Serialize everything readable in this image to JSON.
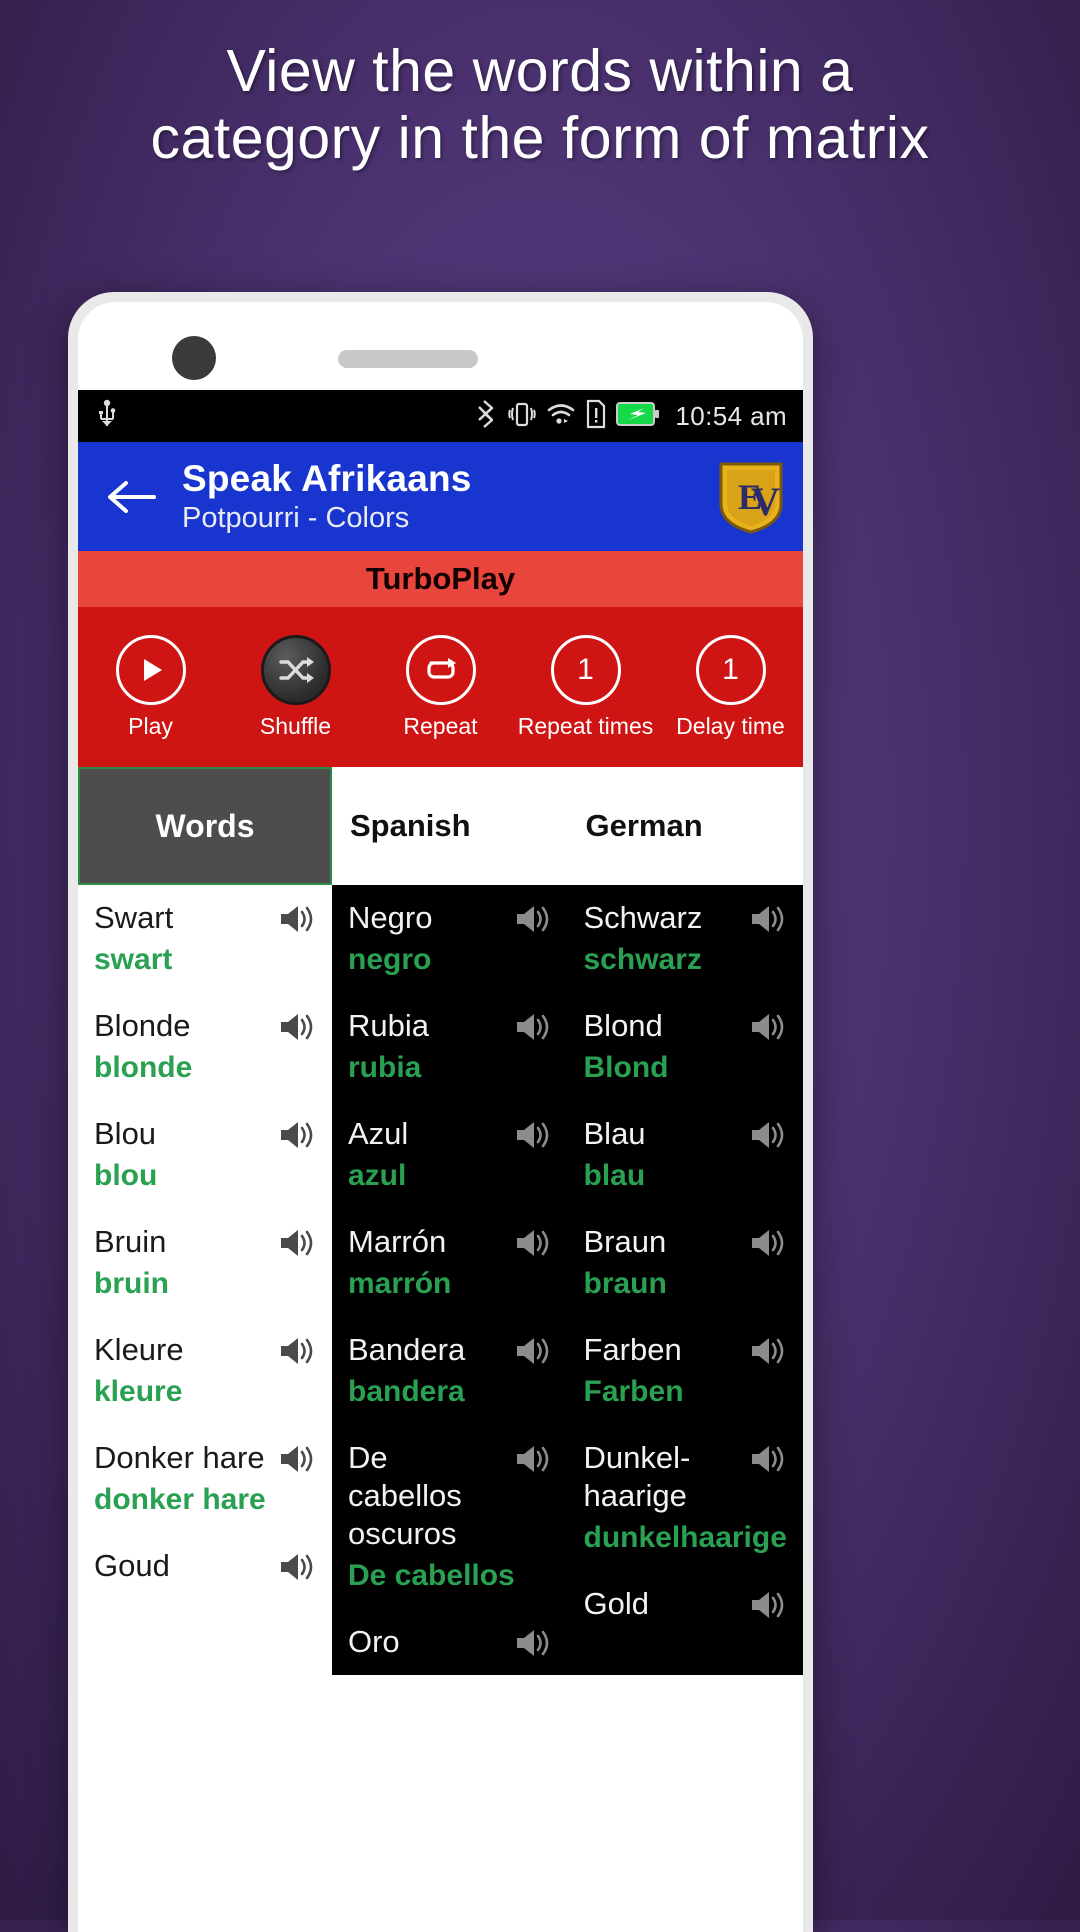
{
  "headline": "View the words within a category in the form of matrix",
  "statusbar": {
    "clock": "10:54 am",
    "left_icons": [
      "usb-icon"
    ],
    "right_icons": [
      "bluetooth-icon",
      "vibrate-icon",
      "wifi-icon",
      "sim-alert-icon",
      "battery-charging-icon"
    ]
  },
  "appbar": {
    "back_icon": "back-arrow-icon",
    "title": "Speak Afrikaans",
    "subtitle": "Potpourri - Colors",
    "logo_text": "EV",
    "bg_color": "#1836cf"
  },
  "turboplay": {
    "title": "TurboPlay",
    "title_bg": "#e8453c",
    "bar_bg": "#cf1414",
    "controls": [
      {
        "label": "Play",
        "icon": "play-icon",
        "value": "",
        "active": false
      },
      {
        "label": "Shuffle",
        "icon": "shuffle-icon",
        "value": "",
        "active": true
      },
      {
        "label": "Repeat",
        "icon": "repeat-icon",
        "value": "",
        "active": false
      },
      {
        "label": "Repeat times",
        "icon": "number",
        "value": "1",
        "active": false
      },
      {
        "label": "Delay time",
        "icon": "number",
        "value": "1",
        "active": false
      }
    ]
  },
  "columns": [
    {
      "label": "Words",
      "selected": true
    },
    {
      "label": "Spanish",
      "selected": false
    },
    {
      "label": "German",
      "selected": false
    }
  ],
  "accent_green": "#2aa052",
  "rows": [
    {
      "words": {
        "word": "Swart",
        "translit": "swart"
      },
      "spanish": {
        "word": "Negro",
        "translit": "negro"
      },
      "german": {
        "word": "Schwarz",
        "translit": "schwarz"
      }
    },
    {
      "words": {
        "word": "Blonde",
        "translit": "blonde"
      },
      "spanish": {
        "word": "Rubia",
        "translit": "rubia"
      },
      "german": {
        "word": "Blond",
        "translit": "Blond"
      }
    },
    {
      "words": {
        "word": "Blou",
        "translit": "blou"
      },
      "spanish": {
        "word": "Azul",
        "translit": "azul"
      },
      "german": {
        "word": "Blau",
        "translit": "blau"
      }
    },
    {
      "words": {
        "word": "Bruin",
        "translit": "bruin"
      },
      "spanish": {
        "word": "Marrón",
        "translit": "marrón"
      },
      "german": {
        "word": "Braun",
        "translit": "braun"
      }
    },
    {
      "words": {
        "word": "Kleure",
        "translit": "kleure"
      },
      "spanish": {
        "word": "Bandera",
        "translit": "bandera"
      },
      "german": {
        "word": "Farben",
        "translit": "Farben"
      }
    },
    {
      "words": {
        "word": "Donker hare",
        "translit": "donker hare"
      },
      "spanish": {
        "word": "De cabellos oscuros",
        "translit": "De cabellos"
      },
      "german": {
        "word": "Dunkel-haarige",
        "translit": "dunkelhaarige"
      }
    },
    {
      "words": {
        "word": "Goud",
        "translit": ""
      },
      "spanish": {
        "word": "Oro",
        "translit": ""
      },
      "german": {
        "word": "Gold",
        "translit": ""
      }
    }
  ]
}
